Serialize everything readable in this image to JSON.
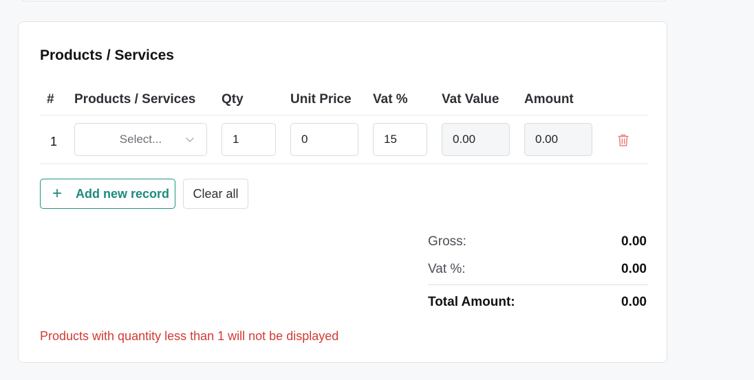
{
  "section": {
    "title": "Products / Services"
  },
  "table": {
    "headers": [
      "#",
      "Products / Services",
      "Qty",
      "Unit Price",
      "Vat %",
      "Vat Value",
      "Amount"
    ],
    "rows": [
      {
        "num": "1",
        "product_placeholder": "Select...",
        "qty": "1",
        "unit_price": "0",
        "vat_percent": "15",
        "vat_value": "0.00",
        "amount": "0.00"
      }
    ]
  },
  "actions": {
    "add_label": "Add new record",
    "add_icon": "+",
    "clear_label": "Clear all"
  },
  "summary": {
    "gross_label": "Gross:",
    "gross_value": "0.00",
    "vat_label": "Vat %:",
    "vat_value": "0.00",
    "total_label": "Total Amount:",
    "total_value": "0.00"
  },
  "note": "Products with quantity less than 1 will not be displayed",
  "colors": {
    "accent": "#1e8a7b",
    "danger": "#d23a34",
    "trash": "#e8807b"
  }
}
